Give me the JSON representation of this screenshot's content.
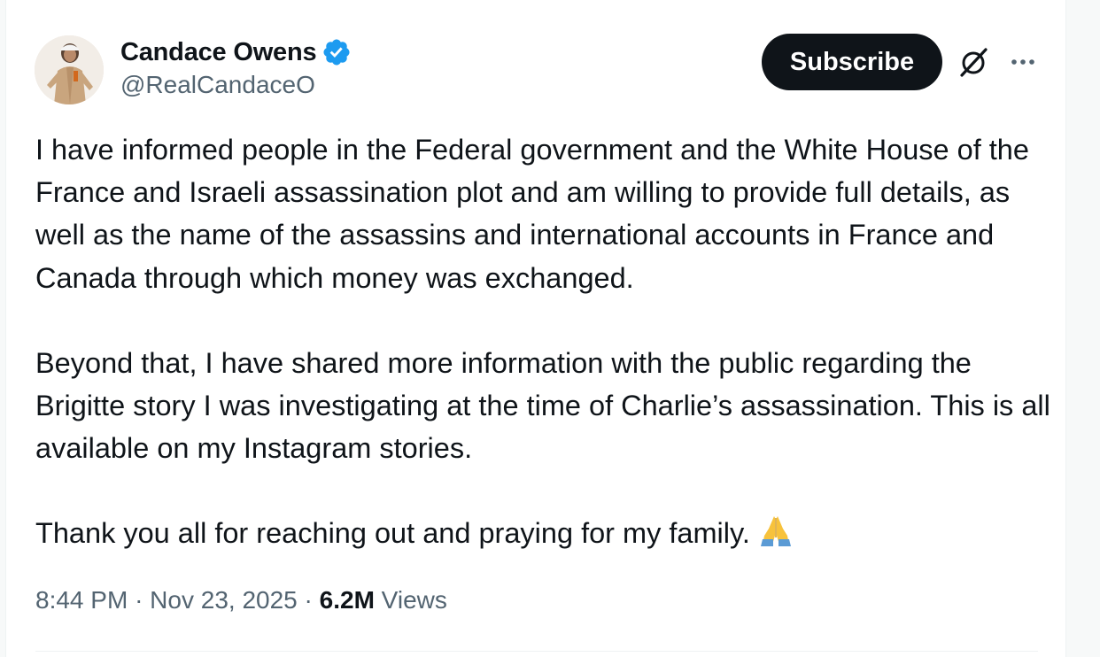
{
  "author": {
    "display_name": "Candace Owens",
    "handle": "@RealCandaceO",
    "verified": true,
    "verified_color": "#1d9bf0"
  },
  "actions": {
    "subscribe_label": "Subscribe",
    "grok_icon": "grok-icon",
    "more_icon": "more-horizontal-icon"
  },
  "tweet": {
    "paragraphs": [
      "I have informed people in the Federal government and the White House of the France and Israeli assassination plot and am willing to provide full details, as well as the name of the assassins and international accounts in France and Canada through which money was exchanged.",
      "Beyond that, I have shared more information with the public regarding the Brigitte story I was investigating at the time of Charlie’s assassination. This is all available on my Instagram stories.",
      "Thank you all for reaching out and praying for my family."
    ],
    "emoji": "folded-hands-emoji"
  },
  "meta": {
    "time": "8:44 PM",
    "separator": "·",
    "date": "Nov 23, 2025",
    "views_count": "6.2M",
    "views_label": "Views"
  },
  "colors": {
    "text_primary": "#0f1419",
    "text_secondary": "#536471",
    "button_bg": "#0f1419",
    "button_text": "#ffffff"
  }
}
